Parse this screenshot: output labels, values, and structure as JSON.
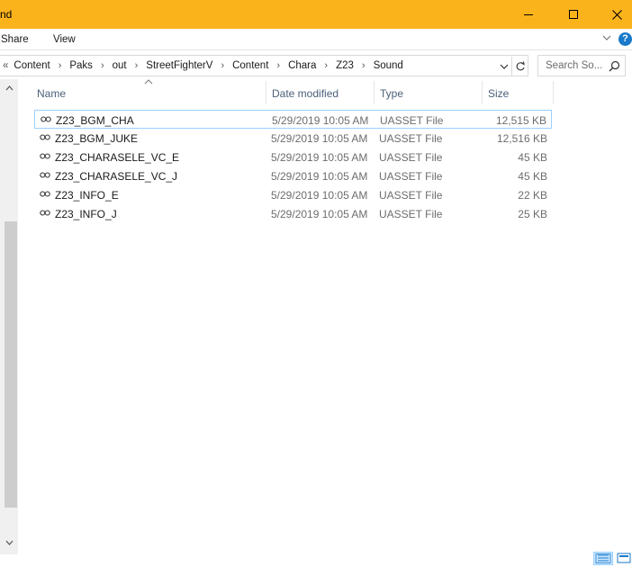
{
  "window": {
    "title": "nd"
  },
  "ribbon": {
    "tabs": [
      "Share",
      "View"
    ]
  },
  "address": {
    "overflow_glyph": "«",
    "crumbs": [
      "Content",
      "Paks",
      "out",
      "StreetFighterV",
      "Content",
      "Chara",
      "Z23",
      "Sound"
    ],
    "separator": "›"
  },
  "search": {
    "placeholder": "Search So..."
  },
  "columns": {
    "name": "Name",
    "date": "Date modified",
    "type": "Type",
    "size": "Size"
  },
  "files": [
    {
      "name": "Z23_BGM_CHA",
      "date": "5/29/2019 10:05 AM",
      "type": "UASSET File",
      "size": "12,515 KB",
      "selected": true
    },
    {
      "name": "Z23_BGM_JUKE",
      "date": "5/29/2019 10:05 AM",
      "type": "UASSET File",
      "size": "12,516 KB"
    },
    {
      "name": "Z23_CHARASELE_VC_E",
      "date": "5/29/2019 10:05 AM",
      "type": "UASSET File",
      "size": "45 KB"
    },
    {
      "name": "Z23_CHARASELE_VC_J",
      "date": "5/29/2019 10:05 AM",
      "type": "UASSET File",
      "size": "45 KB"
    },
    {
      "name": "Z23_INFO_E",
      "date": "5/29/2019 10:05 AM",
      "type": "UASSET File",
      "size": "22 KB"
    },
    {
      "name": "Z23_INFO_J",
      "date": "5/29/2019 10:05 AM",
      "type": "UASSET File",
      "size": "25 KB"
    }
  ],
  "icons": {
    "file": "link-file-icon",
    "minimize": "minimize-icon",
    "maximize": "maximize-icon",
    "close": "close-icon",
    "help": "help-icon",
    "search": "search-icon",
    "refresh": "refresh-icon"
  },
  "colors": {
    "titlebar": "#fbb31c",
    "header_text": "#4c607a",
    "selection_border": "#99d1ff",
    "help": "#1979ca"
  },
  "help_glyph": "?"
}
